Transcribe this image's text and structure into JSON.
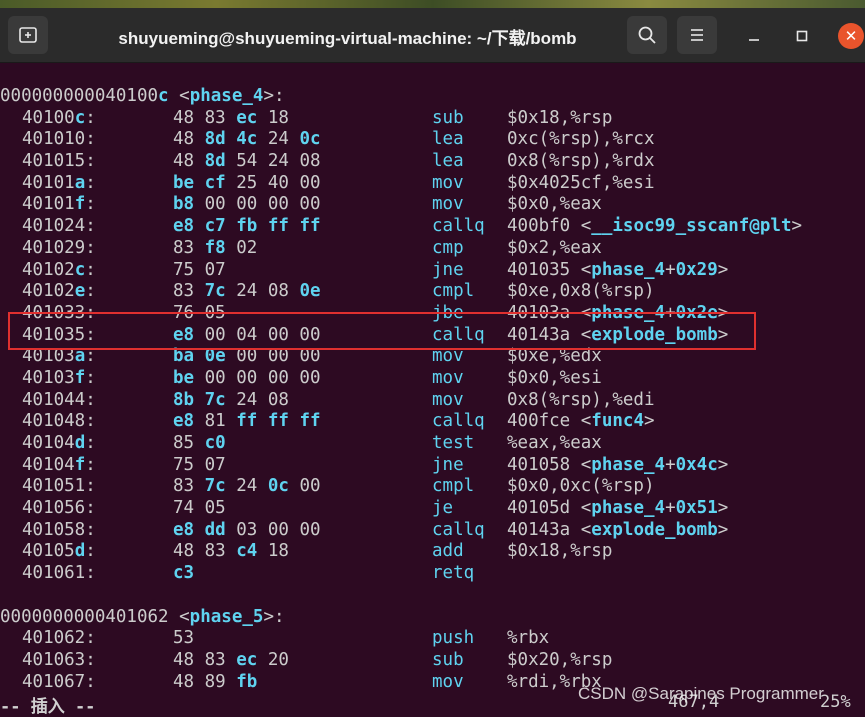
{
  "window": {
    "title": "shuyueming@shuyueming-virtual-machine: ~/下载/bomb",
    "controls": [
      "minimize",
      "maximize",
      "close"
    ]
  },
  "functions": [
    {
      "header_addr": "000000000040100",
      "header_addr_tail": "c",
      "header_name": "<phase_4>:",
      "lines": [
        {
          "addr": "40100c:",
          "hex": "48 83 ec 18",
          "op": "sub",
          "args": "$0x18,%rsp"
        },
        {
          "addr": "401010:",
          "hex": "48 8d 4c 24 0c",
          "op": "lea",
          "args": "0xc(%rsp),%rcx"
        },
        {
          "addr": "401015:",
          "hex": "48 8d 54 24 08",
          "op": "lea",
          "args": "0x8(%rsp),%rdx"
        },
        {
          "addr": "40101a:",
          "hex": "be cf 25 40 00",
          "op": "mov",
          "args": "$0x4025cf,%esi"
        },
        {
          "addr": "40101f:",
          "hex": "b8 00 00 00 00",
          "op": "mov",
          "args": "$0x0,%eax"
        },
        {
          "addr": "401024:",
          "hex": "e8 c7 fb ff ff",
          "op": "callq",
          "args": "400bf0 <__isoc99_sscanf@plt>"
        },
        {
          "addr": "401029:",
          "hex": "83 f8 02",
          "op": "cmp",
          "args": "$0x2,%eax"
        },
        {
          "addr": "40102c:",
          "hex": "75 07",
          "op": "jne",
          "args": "401035 <phase_4+0x29>"
        },
        {
          "addr": "40102e:",
          "hex": "83 7c 24 08 0e",
          "op": "cmpl",
          "args": "$0xe,0x8(%rsp)"
        },
        {
          "addr": "401033:",
          "hex": "76 05",
          "op": "jbe",
          "args": "40103a <phase_4+0x2e>"
        },
        {
          "addr": "401035:",
          "hex": "e8 00 04 00 00",
          "op": "callq",
          "args": "40143a <explode_bomb>"
        },
        {
          "addr": "40103a:",
          "hex": "ba 0e 00 00 00",
          "op": "mov",
          "args": "$0xe,%edx"
        },
        {
          "addr": "40103f:",
          "hex": "be 00 00 00 00",
          "op": "mov",
          "args": "$0x0,%esi"
        },
        {
          "addr": "401044:",
          "hex": "8b 7c 24 08",
          "op": "mov",
          "args": "0x8(%rsp),%edi"
        },
        {
          "addr": "401048:",
          "hex": "e8 81 ff ff ff",
          "op": "callq",
          "args": "400fce <func4>"
        },
        {
          "addr": "40104d:",
          "hex": "85 c0",
          "op": "test",
          "args": "%eax,%eax"
        },
        {
          "addr": "40104f:",
          "hex": "75 07",
          "op": "jne",
          "args": "401058 <phase_4+0x4c>"
        },
        {
          "addr": "401051:",
          "hex": "83 7c 24 0c 00",
          "op": "cmpl",
          "args": "$0x0,0xc(%rsp)"
        },
        {
          "addr": "401056:",
          "hex": "74 05",
          "op": "je",
          "args": "40105d <phase_4+0x51>"
        },
        {
          "addr": "401058:",
          "hex": "e8 dd 03 00 00",
          "op": "callq",
          "args": "40143a <explode_bomb>"
        },
        {
          "addr": "40105d:",
          "hex": "48 83 c4 18",
          "op": "add",
          "args": "$0x18,%rsp"
        },
        {
          "addr": "401061:",
          "hex": "c3",
          "op": "retq",
          "args": ""
        }
      ]
    },
    {
      "header_addr": "0000000000401062",
      "header_addr_tail": "",
      "header_name": "<phase_5>:",
      "lines": [
        {
          "addr": "401062:",
          "hex": "53",
          "op": "push",
          "args": "%rbx"
        },
        {
          "addr": "401063:",
          "hex": "48 83 ec 20",
          "op": "sub",
          "args": "$0x20,%rsp"
        },
        {
          "addr": "401067:",
          "hex": "48 89 fb",
          "op": "mov",
          "args": "%rdi,%rbx"
        }
      ]
    }
  ],
  "status_bar": {
    "mode": "-- 插入 --",
    "position": "467,4",
    "percent": "25%"
  },
  "watermark": "CSDN @Sarapines Programmer",
  "colors": {
    "background": "#2d0a22",
    "accent": "#5fd3f0",
    "highlight_box": "#e0302f",
    "close_button": "#e9542c"
  }
}
